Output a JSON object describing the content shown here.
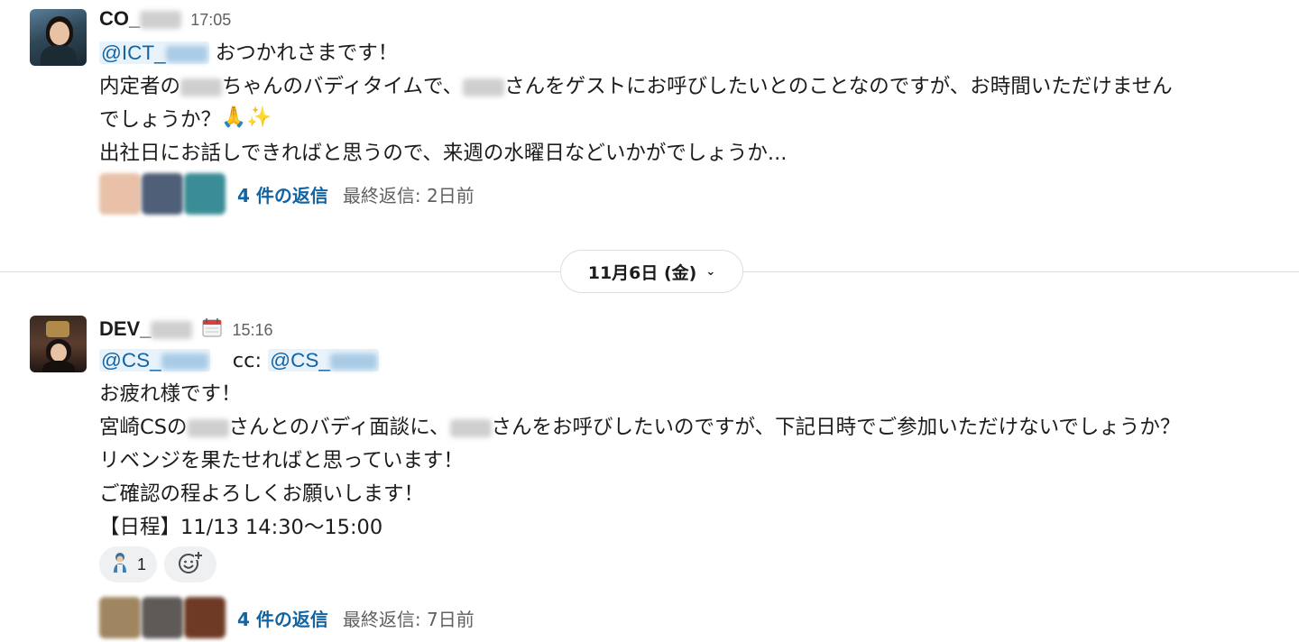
{
  "messages": [
    {
      "sender_prefix": "CO_",
      "time": "17:05",
      "mention_prefix": "@ICT_",
      "greeting": "おつかれさまです！",
      "line2_a": "内定者の",
      "line2_b": "ちゃんのバディタイムで、",
      "line2_c": "さんをゲストにお呼びしたいとのことなのですが、お時間いただけません",
      "line3": "でしょうか？",
      "line3_emoji": "🙏✨",
      "line4": "出社日にお話しできればと思うので、来週の水曜日などいかがでしょうか...",
      "reply_count": "4 件の返信",
      "last_reply": "最終返信: 2日前"
    },
    {
      "sender_prefix": "DEV_",
      "status_icon": "calendar-icon",
      "time": "15:16",
      "mention1_prefix": "@CS_",
      "cc_label": "cc:",
      "mention2_prefix": "@CS_",
      "line1": "お疲れ様です！",
      "line2_a": "宮崎CSの",
      "line2_b": "さんとのバディ面談に、",
      "line2_c": "さんをお呼びしたいのですが、下記日時でご参加いただけないでしょうか？",
      "line3": "リベンジを果たせればと思っています！",
      "line4": "ご確認の程よろしくお願いします！",
      "line5": "【日程】11/13 14:30〜15:00",
      "reaction_count": "1",
      "reply_count": "4 件の返信",
      "last_reply": "最終返信: 7日前"
    }
  ],
  "date_divider": {
    "label": "11月6日 (金)",
    "chevron": "⌄"
  },
  "colors": {
    "link": "#1264a3",
    "mention_bg": "#e8f2fa",
    "muted_text": "#616061",
    "divider": "#dddddd"
  }
}
